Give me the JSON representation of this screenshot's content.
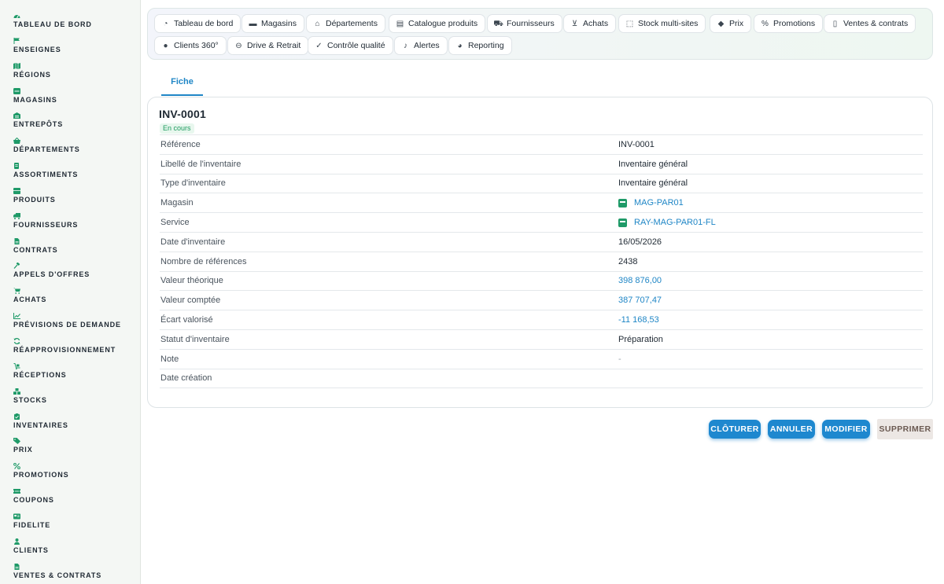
{
  "sidebar": {
    "items": [
      {
        "label": "TABLEAU DE BORD",
        "icon": "dashboard-icon"
      },
      {
        "label": "ENSEIGNES",
        "icon": "flag-icon"
      },
      {
        "label": "RÉGIONS",
        "icon": "map-icon"
      },
      {
        "label": "MAGASINS",
        "icon": "store-icon"
      },
      {
        "label": "ENTREPÔTS",
        "icon": "warehouse-icon"
      },
      {
        "label": "DÉPARTEMENTS",
        "icon": "basket-icon"
      },
      {
        "label": "ASSORTIMENTS",
        "icon": "list-icon"
      },
      {
        "label": "PRODUITS",
        "icon": "box-icon"
      },
      {
        "label": "FOURNISSEURS",
        "icon": "truck-icon"
      },
      {
        "label": "CONTRATS",
        "icon": "document-icon"
      },
      {
        "label": "APPELS D'OFFRES",
        "icon": "gavel-icon"
      },
      {
        "label": "ACHATS",
        "icon": "cart-icon"
      },
      {
        "label": "PRÉVISIONS DE DEMANDE",
        "icon": "chart-line-icon"
      },
      {
        "label": "RÉAPPROVISIONNEMENT",
        "icon": "refresh-icon"
      },
      {
        "label": "RÉCEPTIONS",
        "icon": "delivery-icon"
      },
      {
        "label": "STOCKS",
        "icon": "cubes-icon"
      },
      {
        "label": "INVENTAIRES",
        "icon": "clipboard-icon"
      },
      {
        "label": "PRIX",
        "icon": "tag-icon"
      },
      {
        "label": "PROMOTIONS",
        "icon": "percent-icon"
      },
      {
        "label": "COUPONS",
        "icon": "ticket-icon"
      },
      {
        "label": "FIDELITE",
        "icon": "card-icon"
      },
      {
        "label": "CLIENTS",
        "icon": "user-icon"
      },
      {
        "label": "VENTES & CONTRATS",
        "icon": "document-icon"
      }
    ]
  },
  "modules": {
    "chips": [
      {
        "label": "Tableau de bord",
        "icon": "dashboard-icon"
      },
      {
        "label": "Magasins",
        "icon": "store-icon"
      },
      {
        "label": "Départements",
        "icon": "basket-icon"
      },
      {
        "label": "Catalogue produits",
        "icon": "box-icon"
      },
      {
        "label": "Fournisseurs",
        "icon": "truck-icon"
      },
      {
        "label": "Achats",
        "icon": "cart-icon"
      },
      {
        "label": "Stock multi-sites",
        "icon": "cubes-icon"
      },
      {
        "label": "Prix",
        "icon": "tag-icon"
      },
      {
        "label": "Promotions",
        "icon": "percent-icon"
      },
      {
        "label": "Ventes & contrats",
        "icon": "document-icon"
      },
      {
        "label": "Clients 360°",
        "icon": "user-icon"
      },
      {
        "label": "Drive & Retrait",
        "icon": "car-icon"
      },
      {
        "label": "Contrôle qualité",
        "icon": "check-icon"
      },
      {
        "label": "Alertes",
        "icon": "bell-icon"
      },
      {
        "label": "Reporting",
        "icon": "pie-icon"
      }
    ]
  },
  "tabs": {
    "active": "Fiche"
  },
  "record": {
    "title": "INV-0001",
    "status_badge": "En cours",
    "fields": [
      {
        "label": "Référence",
        "value": "INV-0001",
        "kind": "text"
      },
      {
        "label": "Libellé de l'inventaire",
        "value": "Inventaire général",
        "kind": "text"
      },
      {
        "label": "Type d'inventaire",
        "value": "Inventaire général",
        "kind": "text"
      },
      {
        "label": "Magasin",
        "value": "MAG-PAR01",
        "kind": "link"
      },
      {
        "label": "Service",
        "value": "RAY-MAG-PAR01-FL",
        "kind": "link"
      },
      {
        "label": "Date d'inventaire",
        "value": "16/05/2026",
        "kind": "text"
      },
      {
        "label": "Nombre de références",
        "value": "2438",
        "kind": "text"
      },
      {
        "label": "Valeur théorique",
        "value": "398 876,00",
        "kind": "num"
      },
      {
        "label": "Valeur comptée",
        "value": "387 707,47",
        "kind": "num"
      },
      {
        "label": "Écart valorisé",
        "value": "-11 168,53",
        "kind": "num"
      },
      {
        "label": "Statut d'inventaire",
        "value": "Préparation",
        "kind": "text"
      },
      {
        "label": "Note",
        "value": "-",
        "kind": "muted"
      },
      {
        "label": "Date création",
        "value": "",
        "kind": "text"
      }
    ]
  },
  "actions": {
    "close": "CLÔTURER",
    "cancel": "ANNULER",
    "edit": "MODIFIER",
    "delete": "SUPPRIMER"
  },
  "colors": {
    "accent": "#1e88cf",
    "sidebar_icon": "#1f9a68",
    "badge_text": "#1e9b5f",
    "badge_bg": "#e8f7ee"
  }
}
